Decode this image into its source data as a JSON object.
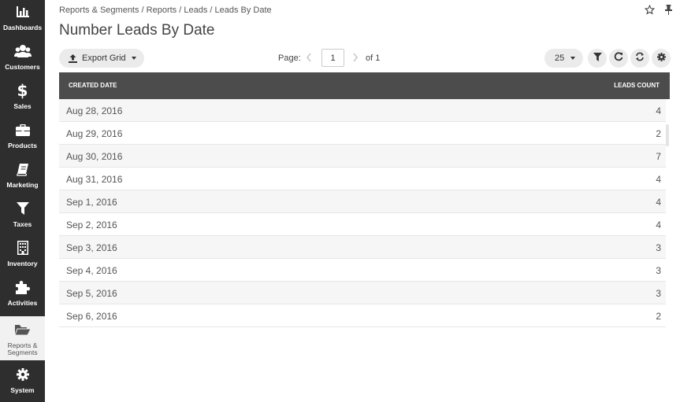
{
  "sidebar": {
    "items": [
      {
        "label": "Dashboards",
        "icon": "bar-chart-icon"
      },
      {
        "label": "Customers",
        "icon": "users-icon"
      },
      {
        "label": "Sales",
        "icon": "dollar-icon"
      },
      {
        "label": "Products",
        "icon": "briefcase-icon"
      },
      {
        "label": "Marketing",
        "icon": "book-icon"
      },
      {
        "label": "Taxes",
        "icon": "filter-icon"
      },
      {
        "label": "Inventory",
        "icon": "building-icon"
      },
      {
        "label": "Activities",
        "icon": "puzzle-icon"
      },
      {
        "label": "Reports &\nSegments",
        "icon": "folder-open-icon",
        "active": true
      },
      {
        "label": "System",
        "icon": "gear-icon"
      }
    ]
  },
  "header": {
    "breadcrumb": "Reports & Segments / Reports / Leads / Leads By Date",
    "title": "Number Leads By Date"
  },
  "toolbar": {
    "export_label": "Export Grid",
    "page_label": "Page:",
    "page_value": "1",
    "page_total": "of 1",
    "page_size": "25"
  },
  "grid": {
    "columns": [
      "CREATED DATE",
      "LEADS COUNT"
    ],
    "rows": [
      {
        "date": "Aug 28, 2016",
        "count": "4"
      },
      {
        "date": "Aug 29, 2016",
        "count": "2"
      },
      {
        "date": "Aug 30, 2016",
        "count": "7"
      },
      {
        "date": "Aug 31, 2016",
        "count": "4"
      },
      {
        "date": "Sep 1, 2016",
        "count": "4"
      },
      {
        "date": "Sep 2, 2016",
        "count": "4"
      },
      {
        "date": "Sep 3, 2016",
        "count": "3"
      },
      {
        "date": "Sep 4, 2016",
        "count": "3"
      },
      {
        "date": "Sep 5, 2016",
        "count": "3"
      },
      {
        "date": "Sep 6, 2016",
        "count": "2"
      }
    ]
  },
  "colors": {
    "sidebar_bg": "#2e2e2e",
    "grid_header_bg": "#4c4c4c",
    "button_bg": "#ebebeb"
  }
}
